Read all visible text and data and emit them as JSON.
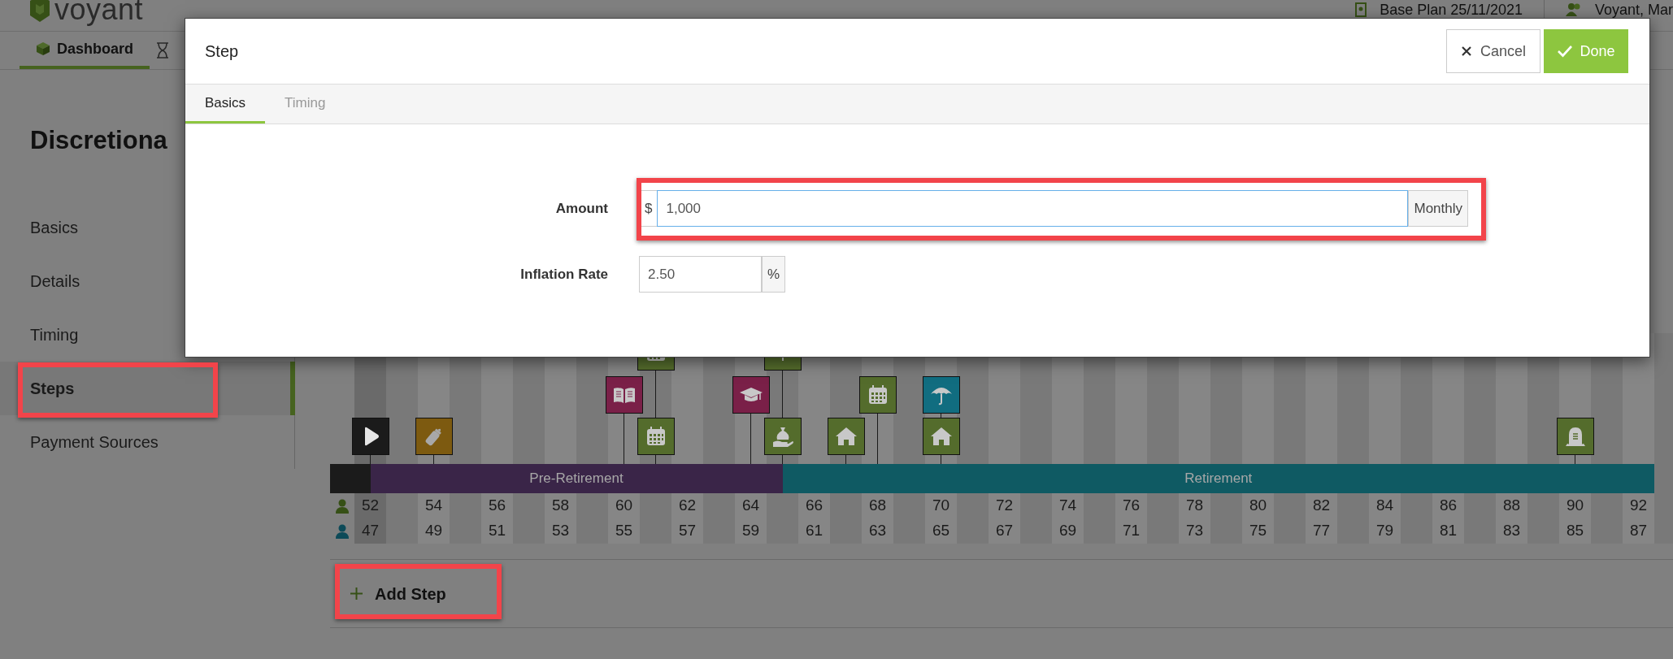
{
  "header": {
    "logo": "voyant",
    "plan": "Base Plan 25/11/2021",
    "user": "Voyant, Mar"
  },
  "nav": {
    "tabs": [
      {
        "label": "Dashboard",
        "selected": true
      }
    ]
  },
  "page": {
    "title": "Discretiona"
  },
  "sidebar": {
    "items": [
      {
        "label": "Basics",
        "selected": false,
        "highlighted": false
      },
      {
        "label": "Details",
        "selected": false,
        "highlighted": false
      },
      {
        "label": "Timing",
        "selected": false,
        "highlighted": false
      },
      {
        "label": "Steps",
        "selected": true,
        "highlighted": true
      },
      {
        "label": "Payment Sources",
        "selected": false,
        "highlighted": false
      }
    ]
  },
  "timeline": {
    "phases": [
      {
        "color": "#1b1b1b",
        "columns": [
          {
            "age_1": "52",
            "age_2": "47",
            "current": true,
            "bottom": {
              "kind": "play",
              "color": "#1b1b1b"
            }
          }
        ]
      },
      {
        "label": "Pre-Retirement",
        "color": "#3a2548",
        "columns": [
          {
            "current": false
          },
          {
            "age_1": "54",
            "age_2": "49",
            "current": false,
            "bottom": {
              "kind": "bottle",
              "color": "#7d5a10"
            }
          },
          {
            "current": false
          },
          {
            "age_1": "56",
            "age_2": "51",
            "current": false
          },
          {
            "current": false
          },
          {
            "age_1": "58",
            "age_2": "53",
            "current": false
          },
          {
            "current": false
          },
          {
            "age_1": "60",
            "age_2": "55",
            "current": false,
            "middle": {
              "kind": "book",
              "color": "#7a2048"
            }
          },
          {
            "current": false,
            "top": {
              "kind": "calendar",
              "color": "#546c2c"
            },
            "bottom": {
              "kind": "calendar",
              "color": "#546c2c"
            }
          },
          {
            "age_1": "62",
            "age_2": "57",
            "current": false
          },
          {
            "current": false
          },
          {
            "age_1": "64",
            "age_2": "59",
            "current": false,
            "middle": {
              "kind": "cap",
              "color": "#7a2048"
            }
          },
          {
            "current": false,
            "top": {
              "kind": "stem",
              "color": "#546c2c"
            },
            "bottom": {
              "kind": "bag",
              "color": "#546c2c"
            }
          }
        ]
      },
      {
        "label": "Retirement",
        "color": "#0f5a63",
        "columns": [
          {
            "age_1": "66",
            "age_2": "61",
            "current": false
          },
          {
            "current": false,
            "bottom": {
              "kind": "house",
              "color": "#546c2c"
            }
          },
          {
            "age_1": "68",
            "age_2": "63",
            "current": false,
            "middle": {
              "kind": "calendar",
              "color": "#546c2c"
            }
          },
          {
            "current": false
          },
          {
            "age_1": "70",
            "age_2": "65",
            "current": false,
            "middle": {
              "kind": "umbrella",
              "color": "#116d80"
            },
            "bottom": {
              "kind": "house",
              "color": "#546c2c"
            }
          },
          {
            "current": false
          },
          {
            "age_1": "72",
            "age_2": "67",
            "current": false
          },
          {
            "current": false
          },
          {
            "age_1": "74",
            "age_2": "69",
            "current": false
          },
          {
            "current": false
          },
          {
            "age_1": "76",
            "age_2": "71",
            "current": false
          },
          {
            "current": false
          },
          {
            "age_1": "78",
            "age_2": "73",
            "current": false
          },
          {
            "current": false
          },
          {
            "age_1": "80",
            "age_2": "75",
            "current": false
          },
          {
            "current": false
          },
          {
            "age_1": "82",
            "age_2": "77",
            "current": false
          },
          {
            "current": false
          },
          {
            "age_1": "84",
            "age_2": "79",
            "current": false
          },
          {
            "current": false
          },
          {
            "age_1": "86",
            "age_2": "81",
            "current": false
          },
          {
            "current": false
          },
          {
            "age_1": "88",
            "age_2": "83",
            "current": false
          },
          {
            "current": false
          },
          {
            "age_1": "90",
            "age_2": "85",
            "current": false,
            "bottom": {
              "kind": "tombstone",
              "color": "#546c2c"
            }
          },
          {
            "current": false
          },
          {
            "age_1": "92",
            "age_2": "87",
            "current": false
          },
          {
            "current": false
          }
        ]
      }
    ]
  },
  "add_step": {
    "label": "Add Step",
    "highlighted": true
  },
  "modal": {
    "title": "Step",
    "buttons": [
      {
        "label": "Cancel",
        "kind": "cancel"
      },
      {
        "label": "Done",
        "kind": "done"
      }
    ],
    "tabs": [
      {
        "label": "Basics",
        "selected": true
      },
      {
        "label": "Timing",
        "selected": false
      }
    ],
    "fields": [
      {
        "label": "Amount",
        "kind": "currency",
        "prefix": "$",
        "value": "1,000",
        "suffix": "Monthly",
        "focused": true,
        "highlighted": true
      },
      {
        "label": "Inflation Rate",
        "kind": "percent",
        "value": "2.50",
        "suffix": "%",
        "focused": false,
        "highlighted": false
      }
    ]
  }
}
